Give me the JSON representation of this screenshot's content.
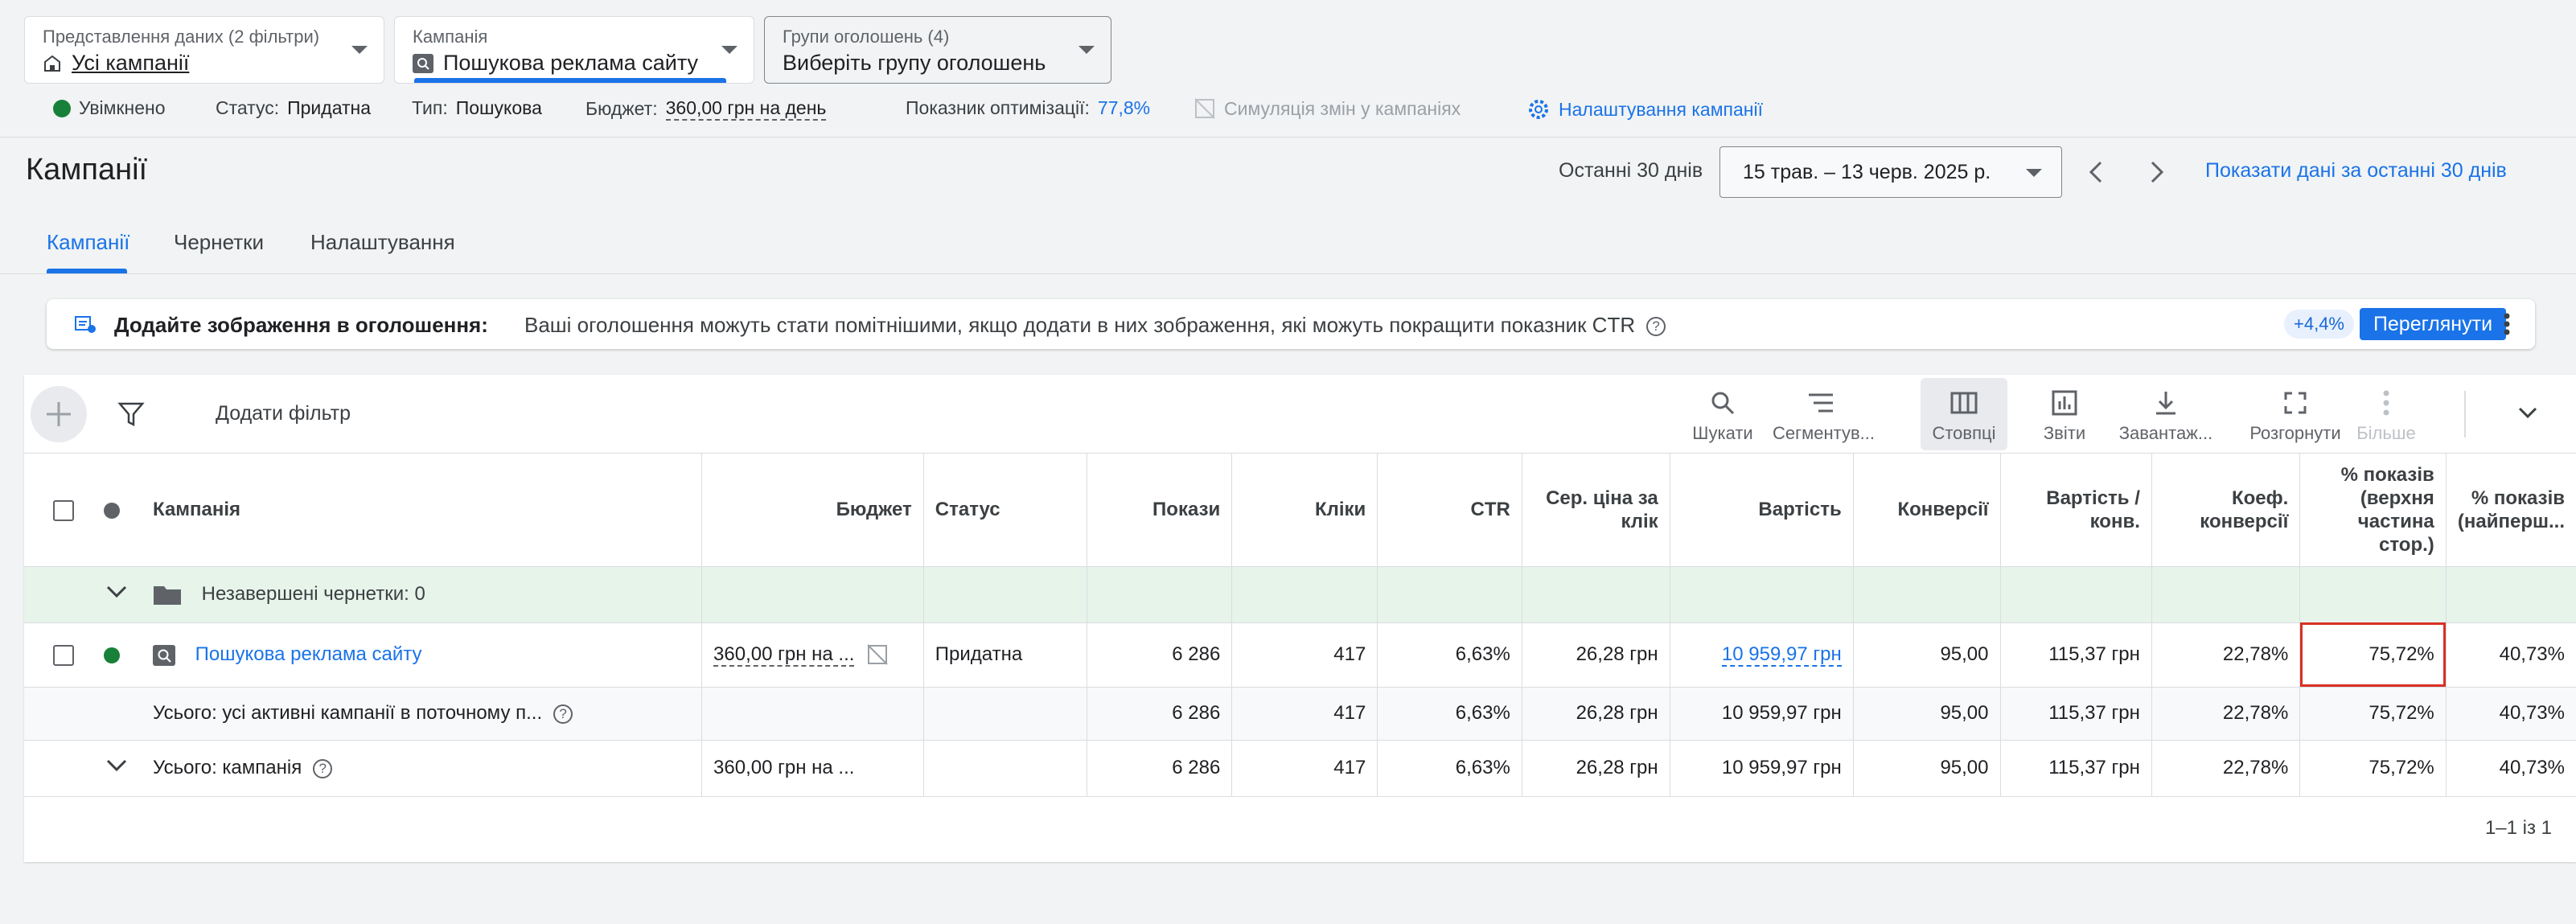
{
  "selectors": {
    "view": {
      "label": "Представлення даних (2 фільтри)",
      "value": "Усі кампанії"
    },
    "campaign": {
      "label": "Кампанія",
      "value": "Пошукова реклама сайту"
    },
    "adgroup": {
      "label": "Групи оголошень (4)",
      "value": "Виберіть групу оголошень"
    }
  },
  "status_bar": {
    "enabled": "Увімкнено",
    "status_label": "Статус:",
    "status_value": "Придатна",
    "type_label": "Тип:",
    "type_value": "Пошукова",
    "budget_label": "Бюджет:",
    "budget_value": "360,00 грн на день",
    "optimization_label": "Показник оптимізації:",
    "optimization_value": "77,8%",
    "simulation": "Симуляція змін у кампаніях",
    "settings": "Налаштування кампанії"
  },
  "page_title": "Кампанії",
  "date": {
    "label": "Останні 30 днів",
    "range": "15 трав. – 13 черв. 2025 р.",
    "show_link": "Показати дані за останні 30 днів"
  },
  "tabs": [
    "Кампанії",
    "Чернетки",
    "Налаштування"
  ],
  "notice": {
    "title": "Додайте зображення в оголошення:",
    "message": "Ваші оголошення можуть стати помітнішими, якщо додати в них зображення, які можуть покращити показник CTR",
    "badge": "+4,4%",
    "button": "Переглянути"
  },
  "toolbar": {
    "add_filter": "Додати фільтр",
    "tools": [
      "Шукати",
      "Сегментув...",
      "Стовпці",
      "Звіти",
      "Завантаж...",
      "Розгорнути",
      "Більше"
    ]
  },
  "table": {
    "headers": [
      "Кампанія",
      "Бюджет",
      "Статус",
      "Покази",
      "Кліки",
      "CTR",
      "Сер. ціна за клік",
      "Вартість",
      "Конверсії",
      "Вартість / конв.",
      "Коеф. конверсії",
      "% показів (верхня частина стор.)",
      "% показів (найперш..."
    ],
    "draft_row": "Незавершені чернетки: 0",
    "campaign_row": [
      "Пошукова реклама сайту",
      "360,00 грн на ...",
      "Придатна",
      "6 286",
      "417",
      "6,63%",
      "26,28 грн",
      "10 959,97 грн",
      "95,00",
      "115,37 грн",
      "22,78%",
      "75,72%",
      "40,73%"
    ],
    "total_active_row": [
      "Усього: усі активні кампанії в поточному п...",
      "",
      "",
      "6 286",
      "417",
      "6,63%",
      "26,28 грн",
      "10 959,97 грн",
      "95,00",
      "115,37 грн",
      "22,78%",
      "75,72%",
      "40,73%"
    ],
    "total_campaign_row": [
      "Усього: кампанія",
      "360,00 грн на ...",
      "",
      "6 286",
      "417",
      "6,63%",
      "26,28 грн",
      "10 959,97 грн",
      "95,00",
      "115,37 грн",
      "22,78%",
      "75,72%",
      "40,73%"
    ]
  },
  "pager": "1–1 із 1",
  "colors": {
    "accent": "#1a73e8",
    "enabled_dot": "#188038",
    "highlight": "#d93025",
    "draft_bg": "#e6f4ea"
  }
}
